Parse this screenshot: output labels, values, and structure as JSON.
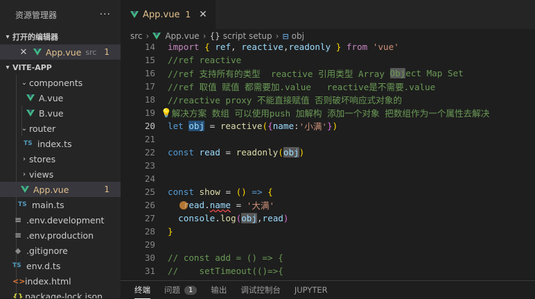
{
  "sidebar": {
    "title": "资源管理器",
    "more": "···",
    "open_editors": {
      "label": "打开的编辑器",
      "item": {
        "name": "App.vue",
        "tag": "src",
        "count": "1"
      }
    },
    "project": {
      "label": "VITE-APP",
      "items": [
        {
          "name": "components"
        },
        {
          "name": "A.vue"
        },
        {
          "name": "B.vue"
        },
        {
          "name": "router"
        },
        {
          "name": "index.ts",
          "icon": "TS"
        },
        {
          "name": "stores"
        },
        {
          "name": "views"
        },
        {
          "name": "App.vue",
          "count": "1"
        },
        {
          "name": "main.ts",
          "icon": "TS"
        },
        {
          "name": ".env.development"
        },
        {
          "name": ".env.production"
        },
        {
          "name": ".gitignore"
        },
        {
          "name": "env.d.ts",
          "icon": "TS"
        },
        {
          "name": "index.html"
        },
        {
          "name": "package-lock.json"
        }
      ]
    }
  },
  "tab": {
    "label": "App.vue",
    "count": "1",
    "close": "✕"
  },
  "breadcrumb": {
    "root": "src",
    "file": "App.vue",
    "section": "script setup",
    "symbol_prefix": "{}",
    "symbol": "obj"
  },
  "code": {
    "lines": [
      {
        "n": "14"
      },
      {
        "n": "15"
      },
      {
        "n": "16"
      },
      {
        "n": "17"
      },
      {
        "n": "18"
      },
      {
        "n": "19"
      },
      {
        "n": "20"
      },
      {
        "n": "21"
      },
      {
        "n": "22"
      },
      {
        "n": "23"
      },
      {
        "n": "24"
      },
      {
        "n": "25"
      },
      {
        "n": "26"
      },
      {
        "n": "27"
      },
      {
        "n": "28"
      },
      {
        "n": "29"
      },
      {
        "n": "30"
      },
      {
        "n": "31"
      }
    ],
    "t": {
      "l14_import": "import",
      "l14_ref": "ref",
      "l14_reactive": "reactive",
      "l14_readonly": "readonly",
      "l14_from": "from",
      "l14_vue": "'vue'",
      "l15": "//ref reactive",
      "l16": "//ref 支持所有的类型  reactive 引用类型 Array ",
      "l16_obj": "Obj",
      "l16_rest": "ect Map Set",
      "l17": "//ref 取值 赋值 都需要加.value   reactive是不需要.value",
      "l18": "//reactive proxy 不能直接赋值 否则破坏响应式对象的",
      "l19_bulb": "💡",
      "l19": "解决方案 数组 可以使用push 加解构 添加一个对象 把数组作为一个属性去解决",
      "l20_let": "let",
      "l20_obj": "obj",
      "l20_reactive": "reactive",
      "l20_name": "name",
      "l20_str": "'小满'",
      "l22_const": "const",
      "l22_read": "read",
      "l22_readonly": "readonly",
      "l22_obj": "obj",
      "l25_const": "const",
      "l25_show": "show",
      "l26_read": "read",
      "l26_name": "name",
      "l26_str": "'大满'",
      "l27_console": "console",
      "l27_log": "log",
      "l27_obj": "obj",
      "l27_read": "read",
      "l30": "// const add = () => {",
      "l31": "//    setTimeout(()=>{"
    }
  },
  "panel": {
    "tabs": [
      {
        "label": "终端"
      },
      {
        "label": "问题",
        "badge": "1"
      },
      {
        "label": "输出"
      },
      {
        "label": "调试控制台"
      },
      {
        "label": "JUPYTER"
      }
    ]
  }
}
